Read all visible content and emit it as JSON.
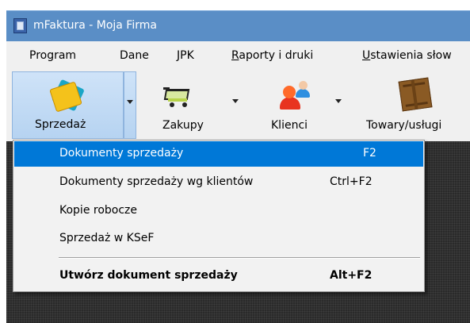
{
  "window": {
    "title": "mFaktura - Moja Firma",
    "accent_color": "#5a8ec6"
  },
  "menubar": {
    "items": [
      {
        "label": "Program"
      },
      {
        "label": "Dane"
      },
      {
        "label": "JPK"
      },
      {
        "label_ul": "R",
        "label_rest": "aporty i druki"
      },
      {
        "label_ul": "U",
        "label_rest": "stawienia słow"
      }
    ]
  },
  "toolbar": {
    "buttons": [
      {
        "label": "Sprzedaż",
        "icon": "sales-documents-icon"
      },
      {
        "label": "Zakupy",
        "icon": "shopping-cart-icon"
      },
      {
        "label": "Klienci",
        "icon": "clients-icon"
      },
      {
        "label": "Towary/usługi",
        "icon": "goods-box-icon"
      }
    ]
  },
  "dropdown": {
    "items": [
      {
        "label": "Dokumenty sprzedaży",
        "shortcut": "F2"
      },
      {
        "label": "Dokumenty sprzedaży wg klientów",
        "shortcut": "Ctrl+F2"
      },
      {
        "label": "Kopie robocze",
        "shortcut": ""
      },
      {
        "label": "Sprzedaż w KSeF",
        "shortcut": ""
      },
      {
        "label": "Utwórz dokument sprzedaży",
        "shortcut": "Alt+F2"
      }
    ],
    "highlight_color": "#0078d7"
  }
}
